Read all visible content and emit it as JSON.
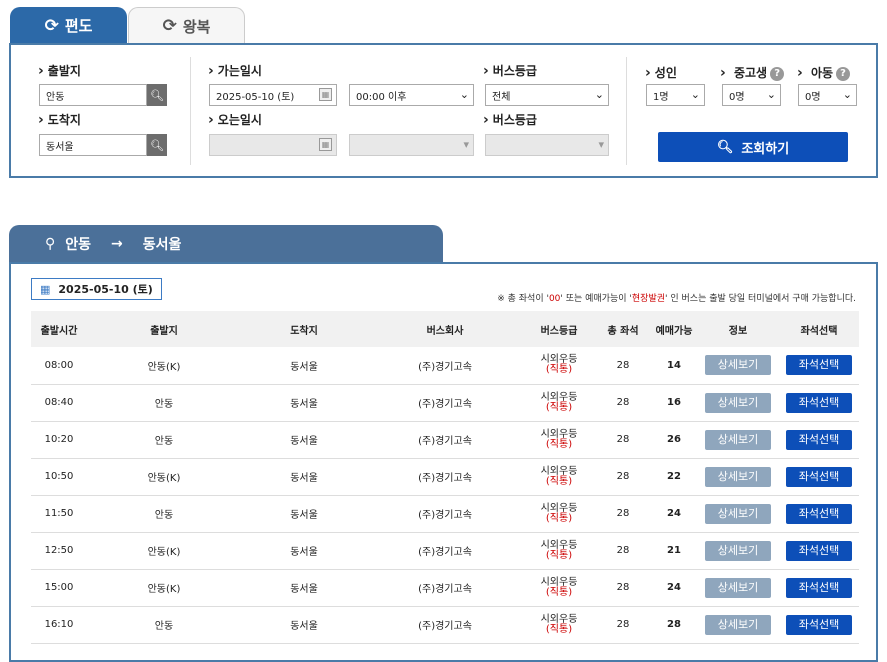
{
  "tabs": [
    {
      "label": "편도",
      "icon": "refresh-icon"
    },
    {
      "label": "왕복",
      "icon": "refresh-icon"
    }
  ],
  "search": {
    "departure_label": "출발지",
    "departure_value": "안동",
    "arrival_label": "도착지",
    "arrival_value": "동서울",
    "go_date_label": "가는일시",
    "go_date_value": "2025-05-10 (토)",
    "go_time_value": "00:00 이후",
    "return_date_label": "오는일시",
    "grade_label": "버스등급",
    "grade_value": "전체",
    "grade_label2": "버스등급",
    "adult_label": "성인",
    "adult_value": "1명",
    "student_label": "중고생",
    "student_value": "0명",
    "child_label": "아동",
    "child_value": "0명",
    "query_button": "조회하기"
  },
  "route": {
    "from": "안동",
    "arrow": "→",
    "to": "동서울"
  },
  "results": {
    "date": "2025-05-10 (토)",
    "notice_prefix": "※ 총 좌석이 '",
    "notice_zero": "00",
    "notice_mid": "' 또는 예매가능이 '",
    "notice_onsite": "현장발권",
    "notice_suffix": "' 인 버스는 출발 당일 터미널에서 구매 가능합니다.",
    "columns": [
      "출발시간",
      "출발지",
      "도착지",
      "버스회사",
      "버스등급",
      "총 좌석",
      "예매가능",
      "정보",
      "좌석선택"
    ],
    "detail_label": "상세보기",
    "seat_label": "좌석선택",
    "rows": [
      {
        "time": "08:00",
        "from": "안동(K)",
        "to": "동서울",
        "company": "(주)경기고속",
        "grade": "시외우등",
        "grade_sub": "(직통)",
        "total": "28",
        "avail": "14"
      },
      {
        "time": "08:40",
        "from": "안동",
        "to": "동서울",
        "company": "(주)경기고속",
        "grade": "시외우등",
        "grade_sub": "(직통)",
        "total": "28",
        "avail": "16"
      },
      {
        "time": "10:20",
        "from": "안동",
        "to": "동서울",
        "company": "(주)경기고속",
        "grade": "시외우등",
        "grade_sub": "(직통)",
        "total": "28",
        "avail": "26"
      },
      {
        "time": "10:50",
        "from": "안동(K)",
        "to": "동서울",
        "company": "(주)경기고속",
        "grade": "시외우등",
        "grade_sub": "(직통)",
        "total": "28",
        "avail": "22"
      },
      {
        "time": "11:50",
        "from": "안동",
        "to": "동서울",
        "company": "(주)경기고속",
        "grade": "시외우등",
        "grade_sub": "(직통)",
        "total": "28",
        "avail": "24"
      },
      {
        "time": "12:50",
        "from": "안동(K)",
        "to": "동서울",
        "company": "(주)경기고속",
        "grade": "시외우등",
        "grade_sub": "(직통)",
        "total": "28",
        "avail": "21"
      },
      {
        "time": "15:00",
        "from": "안동(K)",
        "to": "동서울",
        "company": "(주)경기고속",
        "grade": "시외우등",
        "grade_sub": "(직통)",
        "total": "28",
        "avail": "24"
      },
      {
        "time": "16:10",
        "from": "안동",
        "to": "동서울",
        "company": "(주)경기고속",
        "grade": "시외우등",
        "grade_sub": "(직통)",
        "total": "28",
        "avail": "28"
      }
    ]
  },
  "colors": {
    "primary": "#2c69a8",
    "button": "#0d4fb8",
    "detail_button": "#8fa6bd",
    "route_tab": "#4b7099",
    "accent_red": "#cc0000"
  }
}
